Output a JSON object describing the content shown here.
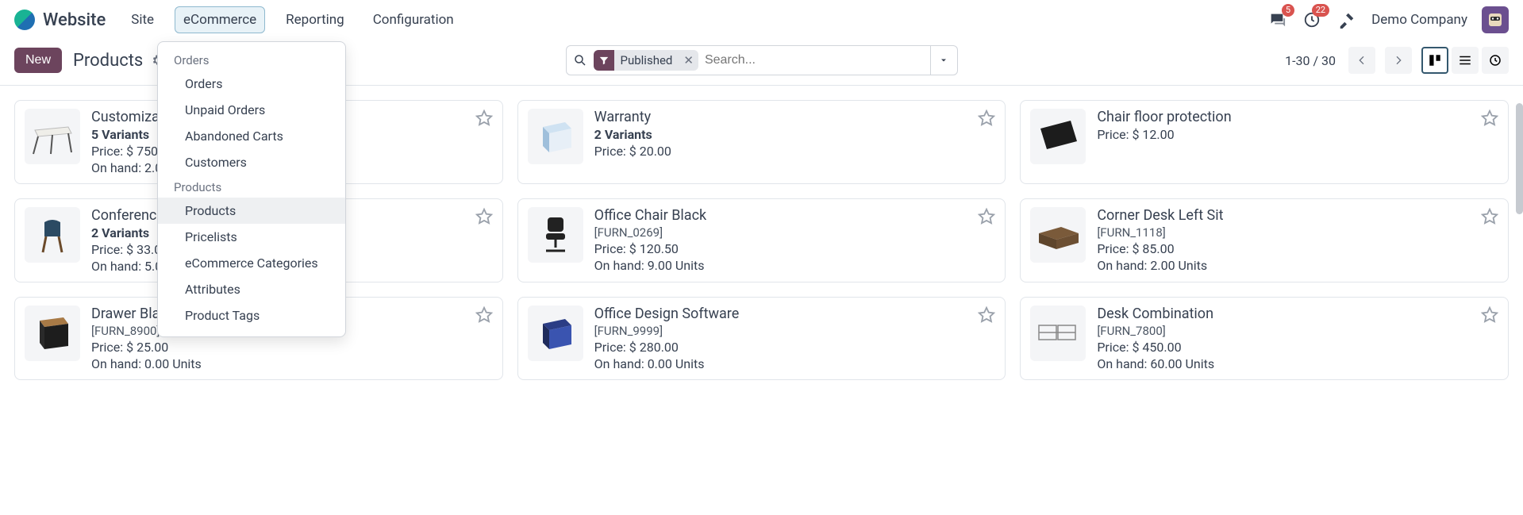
{
  "brand": "Website",
  "nav": {
    "items": [
      "Site",
      "eCommerce",
      "Reporting",
      "Configuration"
    ],
    "active_index": 1
  },
  "badges": {
    "chat": "5",
    "activities": "22"
  },
  "company": "Demo Company",
  "control": {
    "new_label": "New",
    "breadcrumb": "Products"
  },
  "search": {
    "filter_label": "Published",
    "placeholder": "Search..."
  },
  "pager": "1-30 / 30",
  "dropdown": {
    "sections": [
      {
        "header": "Orders",
        "items": [
          "Orders",
          "Unpaid Orders",
          "Abandoned Carts",
          "Customers"
        ]
      },
      {
        "header": "Products",
        "items": [
          "Products",
          "Pricelists",
          "eCommerce Categories",
          "Attributes",
          "Product Tags"
        ],
        "highlight_index": 0
      }
    ]
  },
  "products": [
    {
      "title": "Customizable Desk",
      "variants": "5 Variants",
      "sku": "",
      "price": "Price: $ 750.00",
      "onhand": "On hand: 2.00 Units",
      "icon": "desk"
    },
    {
      "title": "Warranty",
      "variants": "2 Variants",
      "sku": "",
      "price": "Price: $ 20.00",
      "onhand": "",
      "icon": "warranty"
    },
    {
      "title": "Chair floor protection",
      "variants": "",
      "sku": "",
      "price": "Price: $ 12.00",
      "onhand": "",
      "icon": "mat"
    },
    {
      "title": "Conference Chair",
      "variants": "2 Variants",
      "sku": "",
      "price": "Price: $ 33.00",
      "onhand": "On hand: 5.00 Units",
      "icon": "chair"
    },
    {
      "title": "Office Chair Black",
      "variants": "",
      "sku": "[FURN_0269]",
      "price": "Price: $ 120.50",
      "onhand": "On hand: 9.00 Units",
      "icon": "officechair"
    },
    {
      "title": "Corner Desk Left Sit",
      "variants": "",
      "sku": "[FURN_1118]",
      "price": "Price: $ 85.00",
      "onhand": "On hand: 2.00 Units",
      "icon": "corner"
    },
    {
      "title": "Drawer Black",
      "variants": "",
      "sku": "[FURN_8900]",
      "price": "Price: $ 25.00",
      "onhand": "On hand: 0.00 Units",
      "icon": "drawer"
    },
    {
      "title": "Office Design Software",
      "variants": "",
      "sku": "[FURN_9999]",
      "price": "Price: $ 280.00",
      "onhand": "On hand: 0.00 Units",
      "icon": "software"
    },
    {
      "title": "Desk Combination",
      "variants": "",
      "sku": "[FURN_7800]",
      "price": "Price: $ 450.00",
      "onhand": "On hand: 60.00 Units",
      "icon": "combo"
    }
  ]
}
